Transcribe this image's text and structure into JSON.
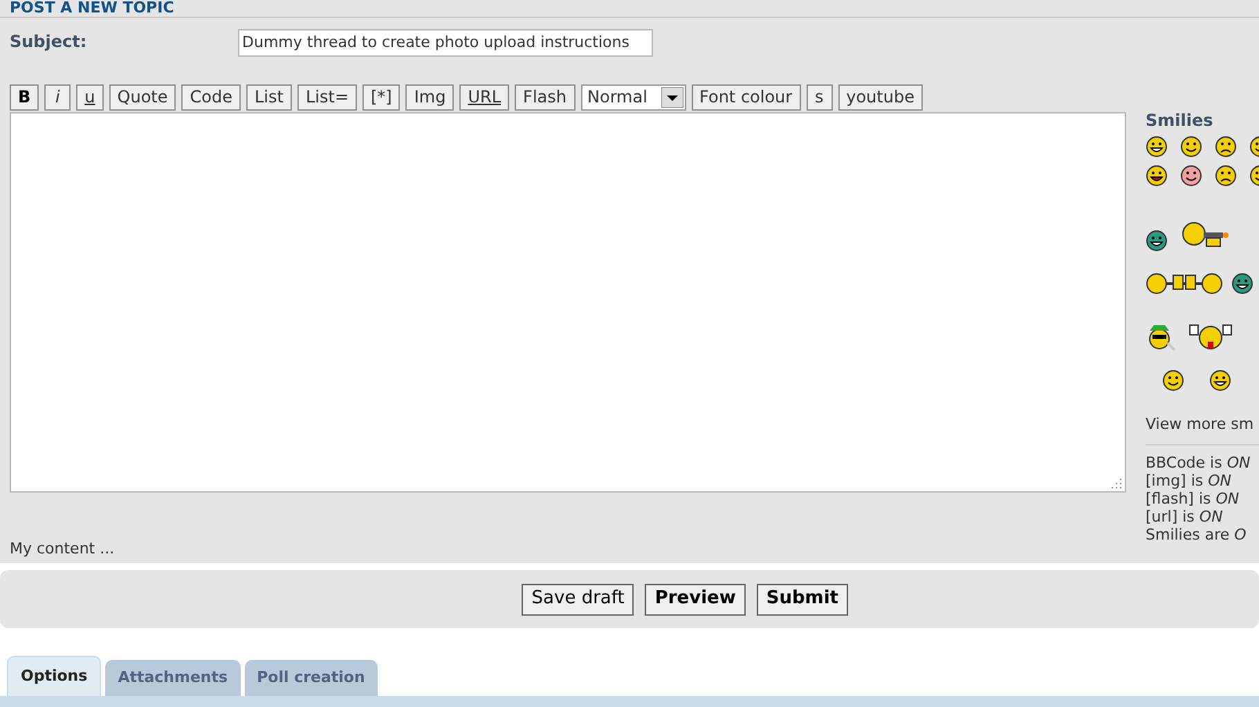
{
  "heading": "POST A NEW TOPIC",
  "subject": {
    "label": "Subject:",
    "value": "Dummy thread to create photo upload instructions"
  },
  "toolbar": [
    {
      "label": "B",
      "kind": "bold"
    },
    {
      "label": "i",
      "kind": "italic"
    },
    {
      "label": "u",
      "kind": "underline"
    },
    {
      "label": "Quote",
      "kind": "plain"
    },
    {
      "label": "Code",
      "kind": "plain"
    },
    {
      "label": "List",
      "kind": "plain"
    },
    {
      "label": "List=",
      "kind": "plain"
    },
    {
      "label": "[*]",
      "kind": "item"
    },
    {
      "label": "Img",
      "kind": "plain"
    },
    {
      "label": "URL",
      "kind": "underline"
    },
    {
      "label": "Flash",
      "kind": "plain"
    },
    {
      "label": "Normal",
      "kind": "select"
    },
    {
      "label": "Font colour",
      "kind": "plain"
    },
    {
      "label": "s",
      "kind": "plain"
    },
    {
      "label": "youtube",
      "kind": "plain"
    }
  ],
  "smilies": {
    "title": "Smilies",
    "more_link": "View more sm",
    "status": [
      "BBCode is *ON*",
      "[img] is *ON*",
      "[flash] is *ON*",
      "[url] is *ON*",
      "Smilies are *O*"
    ]
  },
  "signature": "My content ...",
  "actions": [
    {
      "label": "Save draft",
      "primary": false
    },
    {
      "label": "Preview",
      "primary": true
    },
    {
      "label": "Submit",
      "primary": true
    }
  ],
  "tabs": [
    {
      "label": "Options",
      "selected": true
    },
    {
      "label": "Attachments",
      "selected": false
    },
    {
      "label": "Poll creation",
      "selected": false
    }
  ]
}
